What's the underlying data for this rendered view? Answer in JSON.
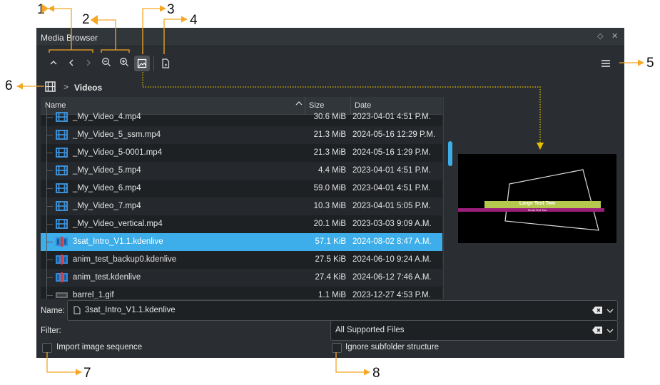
{
  "callouts": [
    "1",
    "2",
    "3",
    "4",
    "5",
    "6",
    "7",
    "8"
  ],
  "window": {
    "title": "Media Browser",
    "float_icon": "float-diamond-icon",
    "close_icon": "close-x-icon"
  },
  "toolbar": {
    "buttons": [
      "up-arrow-icon",
      "back-icon",
      "forward-icon",
      "zoom-out-icon",
      "zoom-in-icon",
      "preview-toggle-icon",
      "new-file-icon"
    ],
    "menu_icon": "hamburger-menu-icon"
  },
  "breadcrumb": {
    "root_icon": "film-strip-icon",
    "separator": ">",
    "folder": "Videos"
  },
  "table": {
    "columns": [
      "Name",
      "Size",
      "Date"
    ],
    "rows": [
      {
        "name": "_My_Video_4.mp4",
        "size": "30.6 MiB",
        "date": "2023-04-01 4:51 P.M.",
        "type": "video"
      },
      {
        "name": "_My_Video_5_ssm.mp4",
        "size": "21.3 MiB",
        "date": "2024-05-16 12:29 P.M.",
        "type": "video"
      },
      {
        "name": "_My_Video_5-0001.mp4",
        "size": "21.3 MiB",
        "date": "2024-05-16 1:29 P.M.",
        "type": "video"
      },
      {
        "name": "_My_Video_5.mp4",
        "size": "4.4 MiB",
        "date": "2023-04-01 4:51 P.M.",
        "type": "video"
      },
      {
        "name": "_My_Video_6.mp4",
        "size": "59.0 MiB",
        "date": "2023-04-01 4:51 P.M.",
        "type": "video"
      },
      {
        "name": "_My_Video_7.mp4",
        "size": "10.3 MiB",
        "date": "2023-04-01 5:05 P.M.",
        "type": "video"
      },
      {
        "name": "_My_Video_vertical.mp4",
        "size": "20.1 MiB",
        "date": "2023-03-03 9:09 A.M.",
        "type": "video"
      },
      {
        "name": "3sat_Intro_V1.1.kdenlive",
        "size": "57.1 KiB",
        "date": "2024-08-02 8:47 A.M.",
        "type": "project",
        "selected": true
      },
      {
        "name": "anim_test_backup0.kdenlive",
        "size": "27.5 KiB",
        "date": "2024-06-10 9:24 A.M.",
        "type": "project"
      },
      {
        "name": "anim_test.kdenlive",
        "size": "27.4 KiB",
        "date": "2024-06-12 7:46 A.M.",
        "type": "project"
      },
      {
        "name": "barrel_1.gif",
        "size": "1.1 MiB",
        "date": "2023-12-27 4:53 P.M.",
        "type": "image"
      }
    ]
  },
  "preview": {
    "line1": "Large Text Two",
    "line2": "Small Text Two"
  },
  "name_field": {
    "label": "Name:",
    "value": "3sat_Intro_V1.1.kdenlive"
  },
  "filter": {
    "label": "Filter:",
    "selected": "All Supported Files"
  },
  "options": {
    "import_sequence": "Import image sequence",
    "ignore_subfolder": "Ignore subfolder structure"
  },
  "colors": {
    "accent": "#3daee9",
    "callout": "#f5a623",
    "panel": "#2a2e32"
  }
}
